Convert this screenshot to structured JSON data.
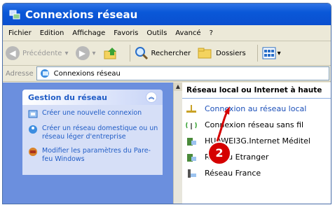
{
  "window": {
    "title": "Connexions réseau"
  },
  "menu": [
    "Fichier",
    "Edition",
    "Affichage",
    "Favoris",
    "Outils",
    "Avancé",
    "?"
  ],
  "toolbar": {
    "back_label": "Précédente",
    "search_label": "Rechercher",
    "folders_label": "Dossiers"
  },
  "address": {
    "label": "Adresse",
    "value": "Connexions réseau"
  },
  "task_panel": {
    "title": "Gestion du réseau",
    "tasks": [
      "Créer une nouvelle connexion",
      "Créer un réseau domestique ou un réseau léger d'entreprise",
      "Modifier les paramètres du Pare-feu Windows"
    ]
  },
  "connections": {
    "header": "Réseau local ou Internet à haute",
    "items": [
      "Connexion au réseau local",
      "Connexion réseau sans fil",
      "HUAWEI3G.Internet Méditel",
      "Réseau Etranger",
      "Réseau France"
    ]
  },
  "annotation": {
    "step": "2",
    "color": "#d50000"
  },
  "colors": {
    "titlebar": "#0b4fcf",
    "task_link": "#215dc6",
    "left_pane": "#6b8fde"
  }
}
